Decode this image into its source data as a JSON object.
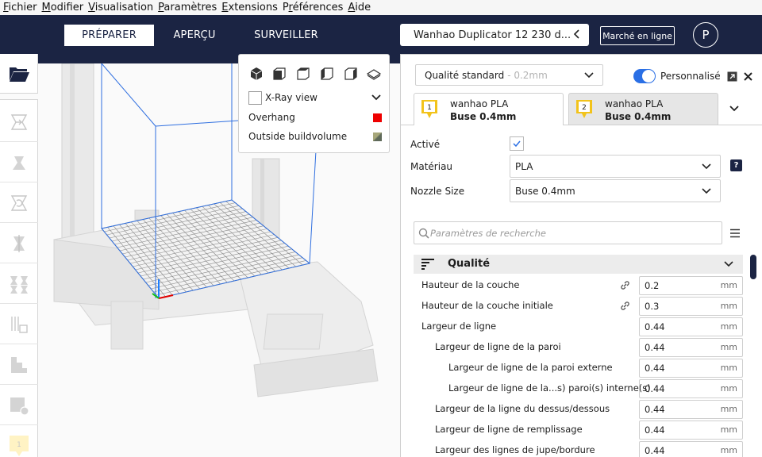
{
  "menu": [
    {
      "label": "Fichier",
      "mnemonic": "F",
      "rest": "ichier"
    },
    {
      "label": "Modifier",
      "mnemonic": "M",
      "rest": "odifier"
    },
    {
      "label": "Visualisation",
      "mnemonic": "V",
      "rest": "isualisation"
    },
    {
      "label": "Paramètres",
      "mnemonic": "P",
      "rest": "aramètres"
    },
    {
      "label": "Extensions",
      "mnemonic": "E",
      "rest": "xtensions"
    },
    {
      "label": "Préférences",
      "mnemonic": "r",
      "pre": "P",
      "rest": "éférences"
    },
    {
      "label": "Aide",
      "mnemonic": "A",
      "rest": "ide"
    }
  ],
  "header": {
    "stages": [
      "PRÉPARER",
      "APERÇU",
      "SURVEILLER"
    ],
    "active_stage": "PRÉPARER",
    "printer_name": "Wanhao Duplicator 12 230 d...",
    "marketplace_label": "Marché en ligne",
    "account_initial": "P"
  },
  "view_popup": {
    "xray_label": "X-Ray view",
    "legend": [
      {
        "label": "Overhang",
        "color": "#ee0000"
      },
      {
        "label": "Outside buildvolume",
        "color": "#8a8f6a"
      }
    ]
  },
  "toolbar": {
    "extruder_badge": "1"
  },
  "panel": {
    "quality_label": "Qualité standard",
    "quality_sub": "- 0.2mm",
    "custom_label": "Personnalisé",
    "accent_color": "#2a6fe5",
    "extruders": [
      {
        "number": "1",
        "material": "wanhao PLA",
        "nozzle": "Buse 0.4mm"
      },
      {
        "number": "2",
        "material": "wanhao PLA",
        "nozzle": "Buse 0.4mm"
      }
    ],
    "enabled_label": "Activé",
    "material_label": "Matériau",
    "material_value": "PLA",
    "material_help": "?",
    "nozzle_label": "Nozzle Size",
    "nozzle_value": "Buse 0.4mm",
    "search_placeholder": "Paramètres de recherche",
    "category_title": "Qualité",
    "settings": [
      {
        "label": "Hauteur de la couche",
        "value": "0.2",
        "unit": "mm",
        "linked": true,
        "indent": 0
      },
      {
        "label": "Hauteur de la couche initiale",
        "value": "0.3",
        "unit": "mm",
        "linked": true,
        "indent": 0
      },
      {
        "label": "Largeur de ligne",
        "value": "0.44",
        "unit": "mm",
        "linked": false,
        "indent": 0
      },
      {
        "label": "Largeur de ligne de la paroi",
        "value": "0.44",
        "unit": "mm",
        "linked": false,
        "indent": 1
      },
      {
        "label": "Largeur de ligne de la paroi externe",
        "value": "0.44",
        "unit": "mm",
        "linked": false,
        "indent": 2
      },
      {
        "label": "Largeur de ligne de la...s) paroi(s) interne(s)",
        "value": "0.44",
        "unit": "mm",
        "linked": false,
        "indent": 2
      },
      {
        "label": "Largeur de la ligne du dessus/dessous",
        "value": "0.44",
        "unit": "mm",
        "linked": false,
        "indent": 1
      },
      {
        "label": "Largeur de ligne de remplissage",
        "value": "0.44",
        "unit": "mm",
        "linked": false,
        "indent": 1
      },
      {
        "label": "Largeur des lignes de jupe/bordure",
        "value": "0.44",
        "unit": "mm",
        "linked": false,
        "indent": 1
      }
    ]
  }
}
